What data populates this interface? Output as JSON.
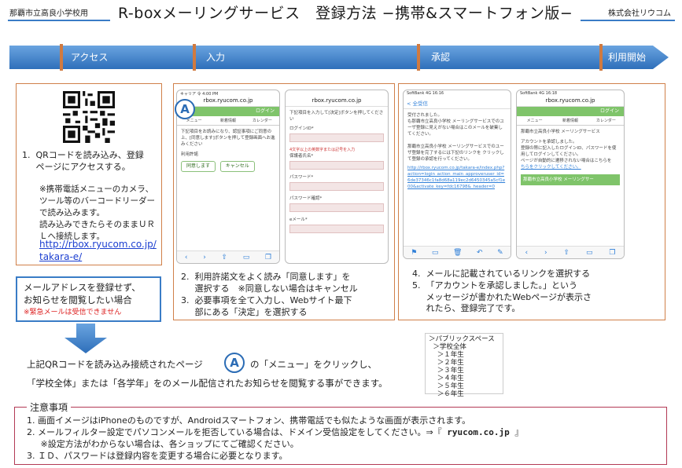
{
  "header": {
    "school": "那覇市立高良小学校用",
    "title": "R-boxメーリングサービス　登録方法 −携帯&スマートフォン版−",
    "company": "株式会社リウコム"
  },
  "stages": [
    "アクセス",
    "入力",
    "承認",
    "利用開始"
  ],
  "colors": {
    "banner": "#3a7cc6",
    "box_border": "#d08049",
    "notes_border": "#b33a55",
    "link": "#1c3fd0"
  },
  "access": {
    "step1": "1.  QRコードを読み込み、登録\n     ページにアクセスする。",
    "note": "※携帯電話メニューのカメラ、\nツール等のバーコードリーダー\nで読み込みます。\n読み込みできたらそのままＵＲ\nＬへ接続します。",
    "url": "http://rbox.ryucom.co.jp/\ntakara-e/"
  },
  "no_register": {
    "text": "メールアドレスを登録せず、\nお知らせを閲覧したい場合",
    "warning": "※緊急メールは受信できません"
  },
  "phone1": {
    "status": "キャリア 令     4:00 PM",
    "url": "rbox.ryucom.co.jp",
    "login": "ログイン",
    "tabs": [
      "メニュー",
      "新着情報",
      "カレンダー"
    ],
    "body": "下記項目をお読みになり、認証事項にご同意の上、[同意します]ボタンを押して登録画面へお進みください",
    "section": "利用許諾",
    "agree": "同意します",
    "cancel": "キャンセル"
  },
  "phone2": {
    "url": "rbox.ryucom.co.jp",
    "body": "下記項目を入力して[決定]ボタンを押してください",
    "fields": [
      "ログインID*",
      "保護者氏名*",
      "パスワード*",
      "パスワード確認*",
      "eメール*"
    ],
    "hint": "4文字以上の英数字または記号を入力"
  },
  "phone3": {
    "status": "SoftBank 4G   16:16",
    "back": "< 全受信",
    "body": "受付されました。\nも那覇市立高良小学校 メーリングサービスでのユーザ登録に見えがない場合はこのメールを破棄してください。\n\n那覇市立高良小学校 メーリングサービスでのユーザ登録を完了するには下記のリンクを クリックして登録の承認を行ってください。",
    "link": "http://rbox.ryucom.co.jp/takara-e/index.php?action=login_action_main_approveruser_id=6de37346c1fa8d68a119ec2d6450345a5cf1e00&activate_key=fdc16798&_header=0"
  },
  "phone4": {
    "status": "SoftBank 4G   16:18",
    "url": "rbox.ryucom.co.jp",
    "login": "ログイン",
    "tabs": [
      "メニュー",
      "新着情報",
      "カレンダー"
    ],
    "school": "那覇市立高良小学校 メーリングサービス",
    "body": "アカウントを承認しました。\n登録の際に記入したログインID、パスワードを使用してログインしてください。\nページが自動的に遷移されない場合はこちらを",
    "link": "ちらをクリックしてください。",
    "footer": "那覇市立高良小学校 メーリングサー"
  },
  "input_steps": [
    "2.  利用許諾文をよく読み「同意します」を\n     選択する　※同意しない場合はキャンセル",
    "3.  必要事項を全て入力し、Webサイト最下\n     部にある「決定」を選択する"
  ],
  "approve_steps": [
    "4.  メールに記載されているリンクを選択する",
    "5.  「アカウントを承認しました。」という\n     メッセージが書かれたWebページが表示さ\n     れたら、登録完了です。"
  ],
  "public_list": [
    "＞パブリックスペース",
    "  ＞学校全体",
    "    ＞１年生",
    "    ＞２年生",
    "    ＞３年生",
    "    ＞４年生",
    "    ＞５年生",
    "    ＞６年生"
  ],
  "circle_label": "A",
  "viewing": {
    "line1_pre": "上記QRコードを読み込み接続されたページ",
    "line1_post": "の「メニュー」をクリックし、",
    "line2": "「学校全体」または「各学年」をのメール配信されたお知らせを閲覧する事ができます。"
  },
  "notes": {
    "title": "注意事項",
    "item1": "1.  画面イメージはiPhoneのものですが、Androidスマートフォン、携帯電話でも似たような画面が表示されます。",
    "item2_pre": "2.  メールフィルター設定でパソコンメールを拒否している場合は、ドメイン受信設定をしてください。⇒『",
    "item2_domain": " ryucom.co.jp ",
    "item2_post": "』",
    "item2_sub": "     ※設定方法がわからない場合は、各ショップにてご確認ください。",
    "item3": "3.  ＩＤ、パスワードは登録内容を変更する場合に必要となります。"
  }
}
